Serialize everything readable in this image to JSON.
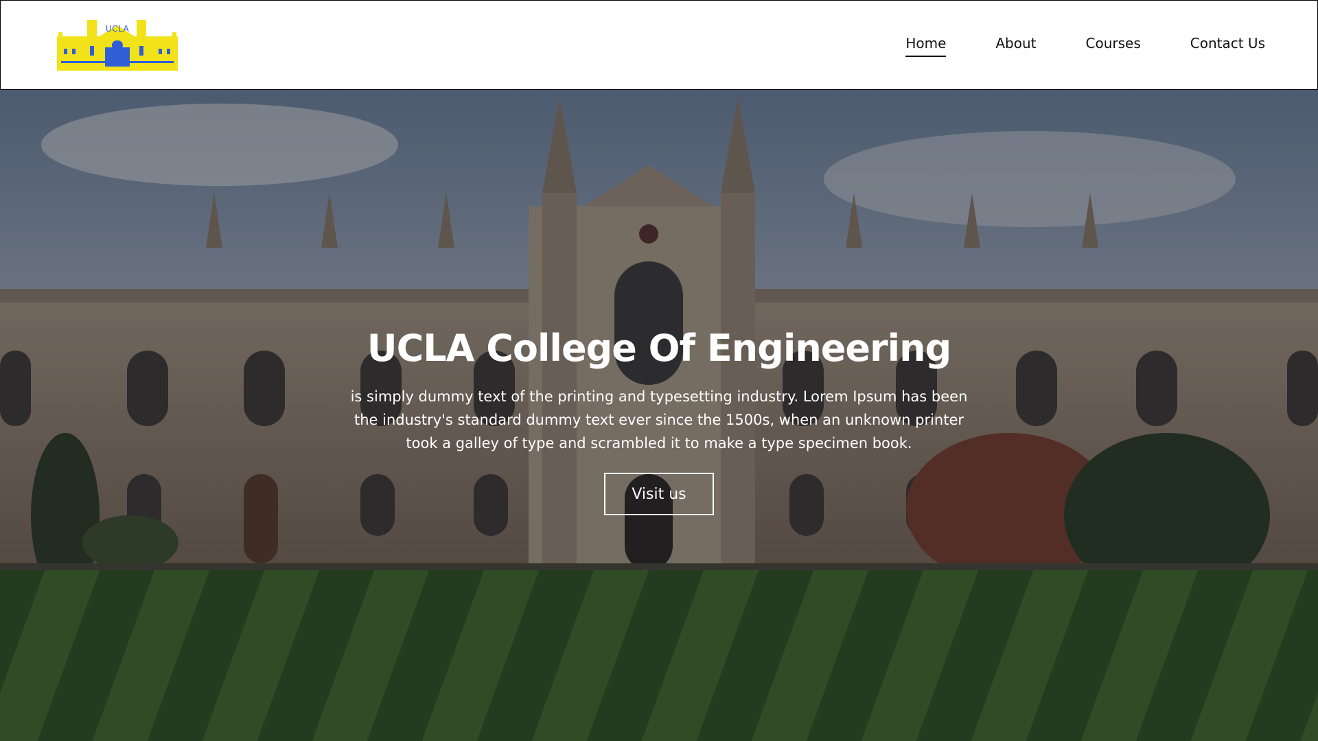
{
  "logo": {
    "text": "UCLA",
    "icon": "castle-logo-icon",
    "colors": {
      "body": "#f2e21a",
      "accent": "#2f5ed8"
    }
  },
  "nav": {
    "items": [
      {
        "label": "Home",
        "active": true
      },
      {
        "label": "About",
        "active": false
      },
      {
        "label": "Courses",
        "active": false
      },
      {
        "label": "Contact Us",
        "active": false
      }
    ]
  },
  "hero": {
    "title": "UCLA College Of Engineering",
    "text": "is simply dummy text of the printing and typesetting industry. Lorem Ipsum has been the industry's standard dummy text ever since the 1500s, when an unknown printer took a galley of type and scrambled it to make a type specimen book.",
    "button_label": "Visit us",
    "background": "college-building-photo"
  }
}
